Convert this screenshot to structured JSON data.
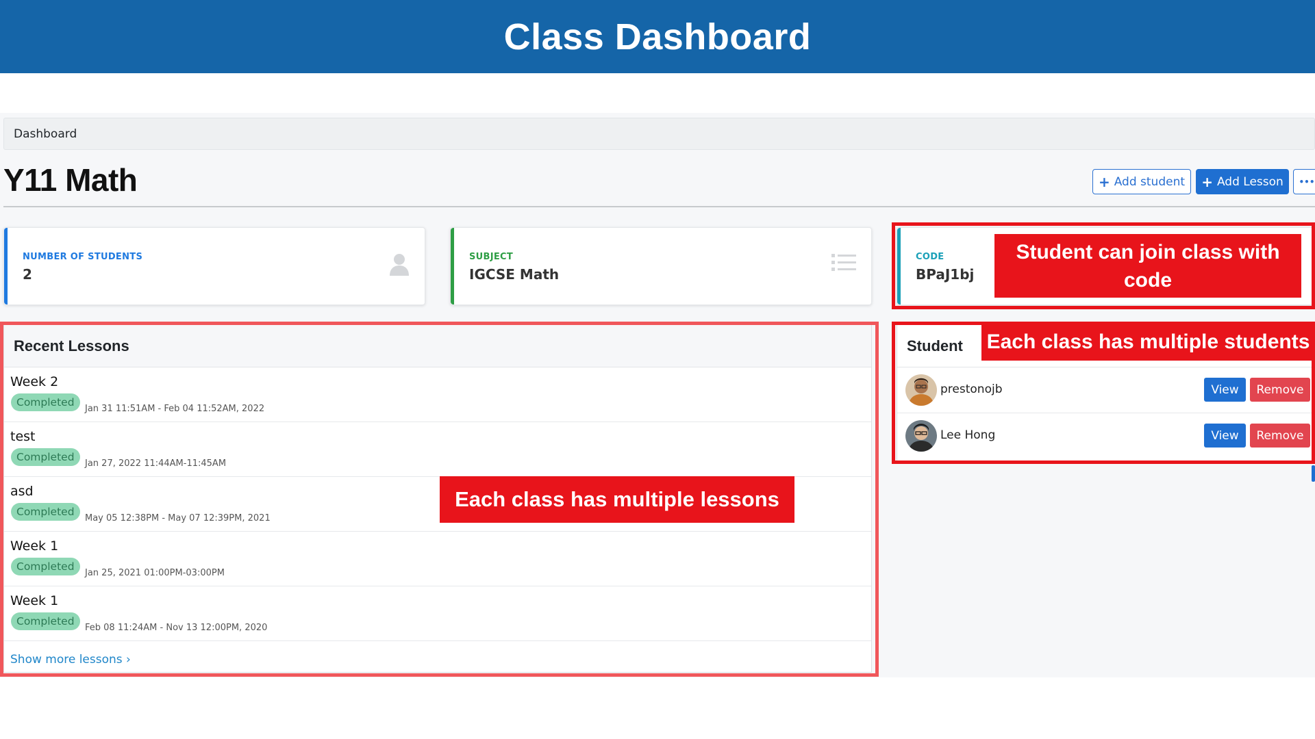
{
  "banner": {
    "title": "Class Dashboard"
  },
  "breadcrumb": {
    "label": "Dashboard"
  },
  "page": {
    "title": "Y11 Math"
  },
  "header_actions": {
    "add_student": "Add student",
    "add_lesson": "Add Lesson",
    "more": "•••"
  },
  "stats": {
    "students": {
      "label": "NUMBER OF STUDENTS",
      "value": "2",
      "color": "#1f7ae0",
      "icon": "person-icon"
    },
    "subject": {
      "label": "SUBJECT",
      "value": "IGCSE Math",
      "color": "#2e9e45",
      "icon": "list-icon"
    },
    "code": {
      "label": "CODE",
      "value": "BPaJ1bj",
      "color": "#1aa0b8"
    }
  },
  "annotations": {
    "code": "Student can join class with code",
    "students": "Each class has multiple students",
    "lessons": "Each class has multiple lessons"
  },
  "lessons": {
    "heading": "Recent Lessons",
    "items": [
      {
        "name": "Week 2",
        "status": "Completed",
        "date": "Jan 31 11:51AM - Feb 04 11:52AM, 2022"
      },
      {
        "name": "test",
        "status": "Completed",
        "date": "Jan 27, 2022 11:44AM-11:45AM"
      },
      {
        "name": "asd",
        "status": "Completed",
        "date": "May 05 12:38PM - May 07 12:39PM, 2021"
      },
      {
        "name": "Week 1",
        "status": "Completed",
        "date": "Jan 25, 2021 01:00PM-03:00PM"
      },
      {
        "name": "Week 1",
        "status": "Completed",
        "date": "Feb 08 11:24AM - Nov 13 12:00PM, 2020"
      }
    ],
    "show_more": "Show more lessons ›"
  },
  "students": {
    "heading": "Student",
    "items": [
      {
        "name": "prestonojb",
        "view": "View",
        "remove": "Remove"
      },
      {
        "name": "Lee Hong",
        "view": "View",
        "remove": "Remove"
      }
    ]
  }
}
